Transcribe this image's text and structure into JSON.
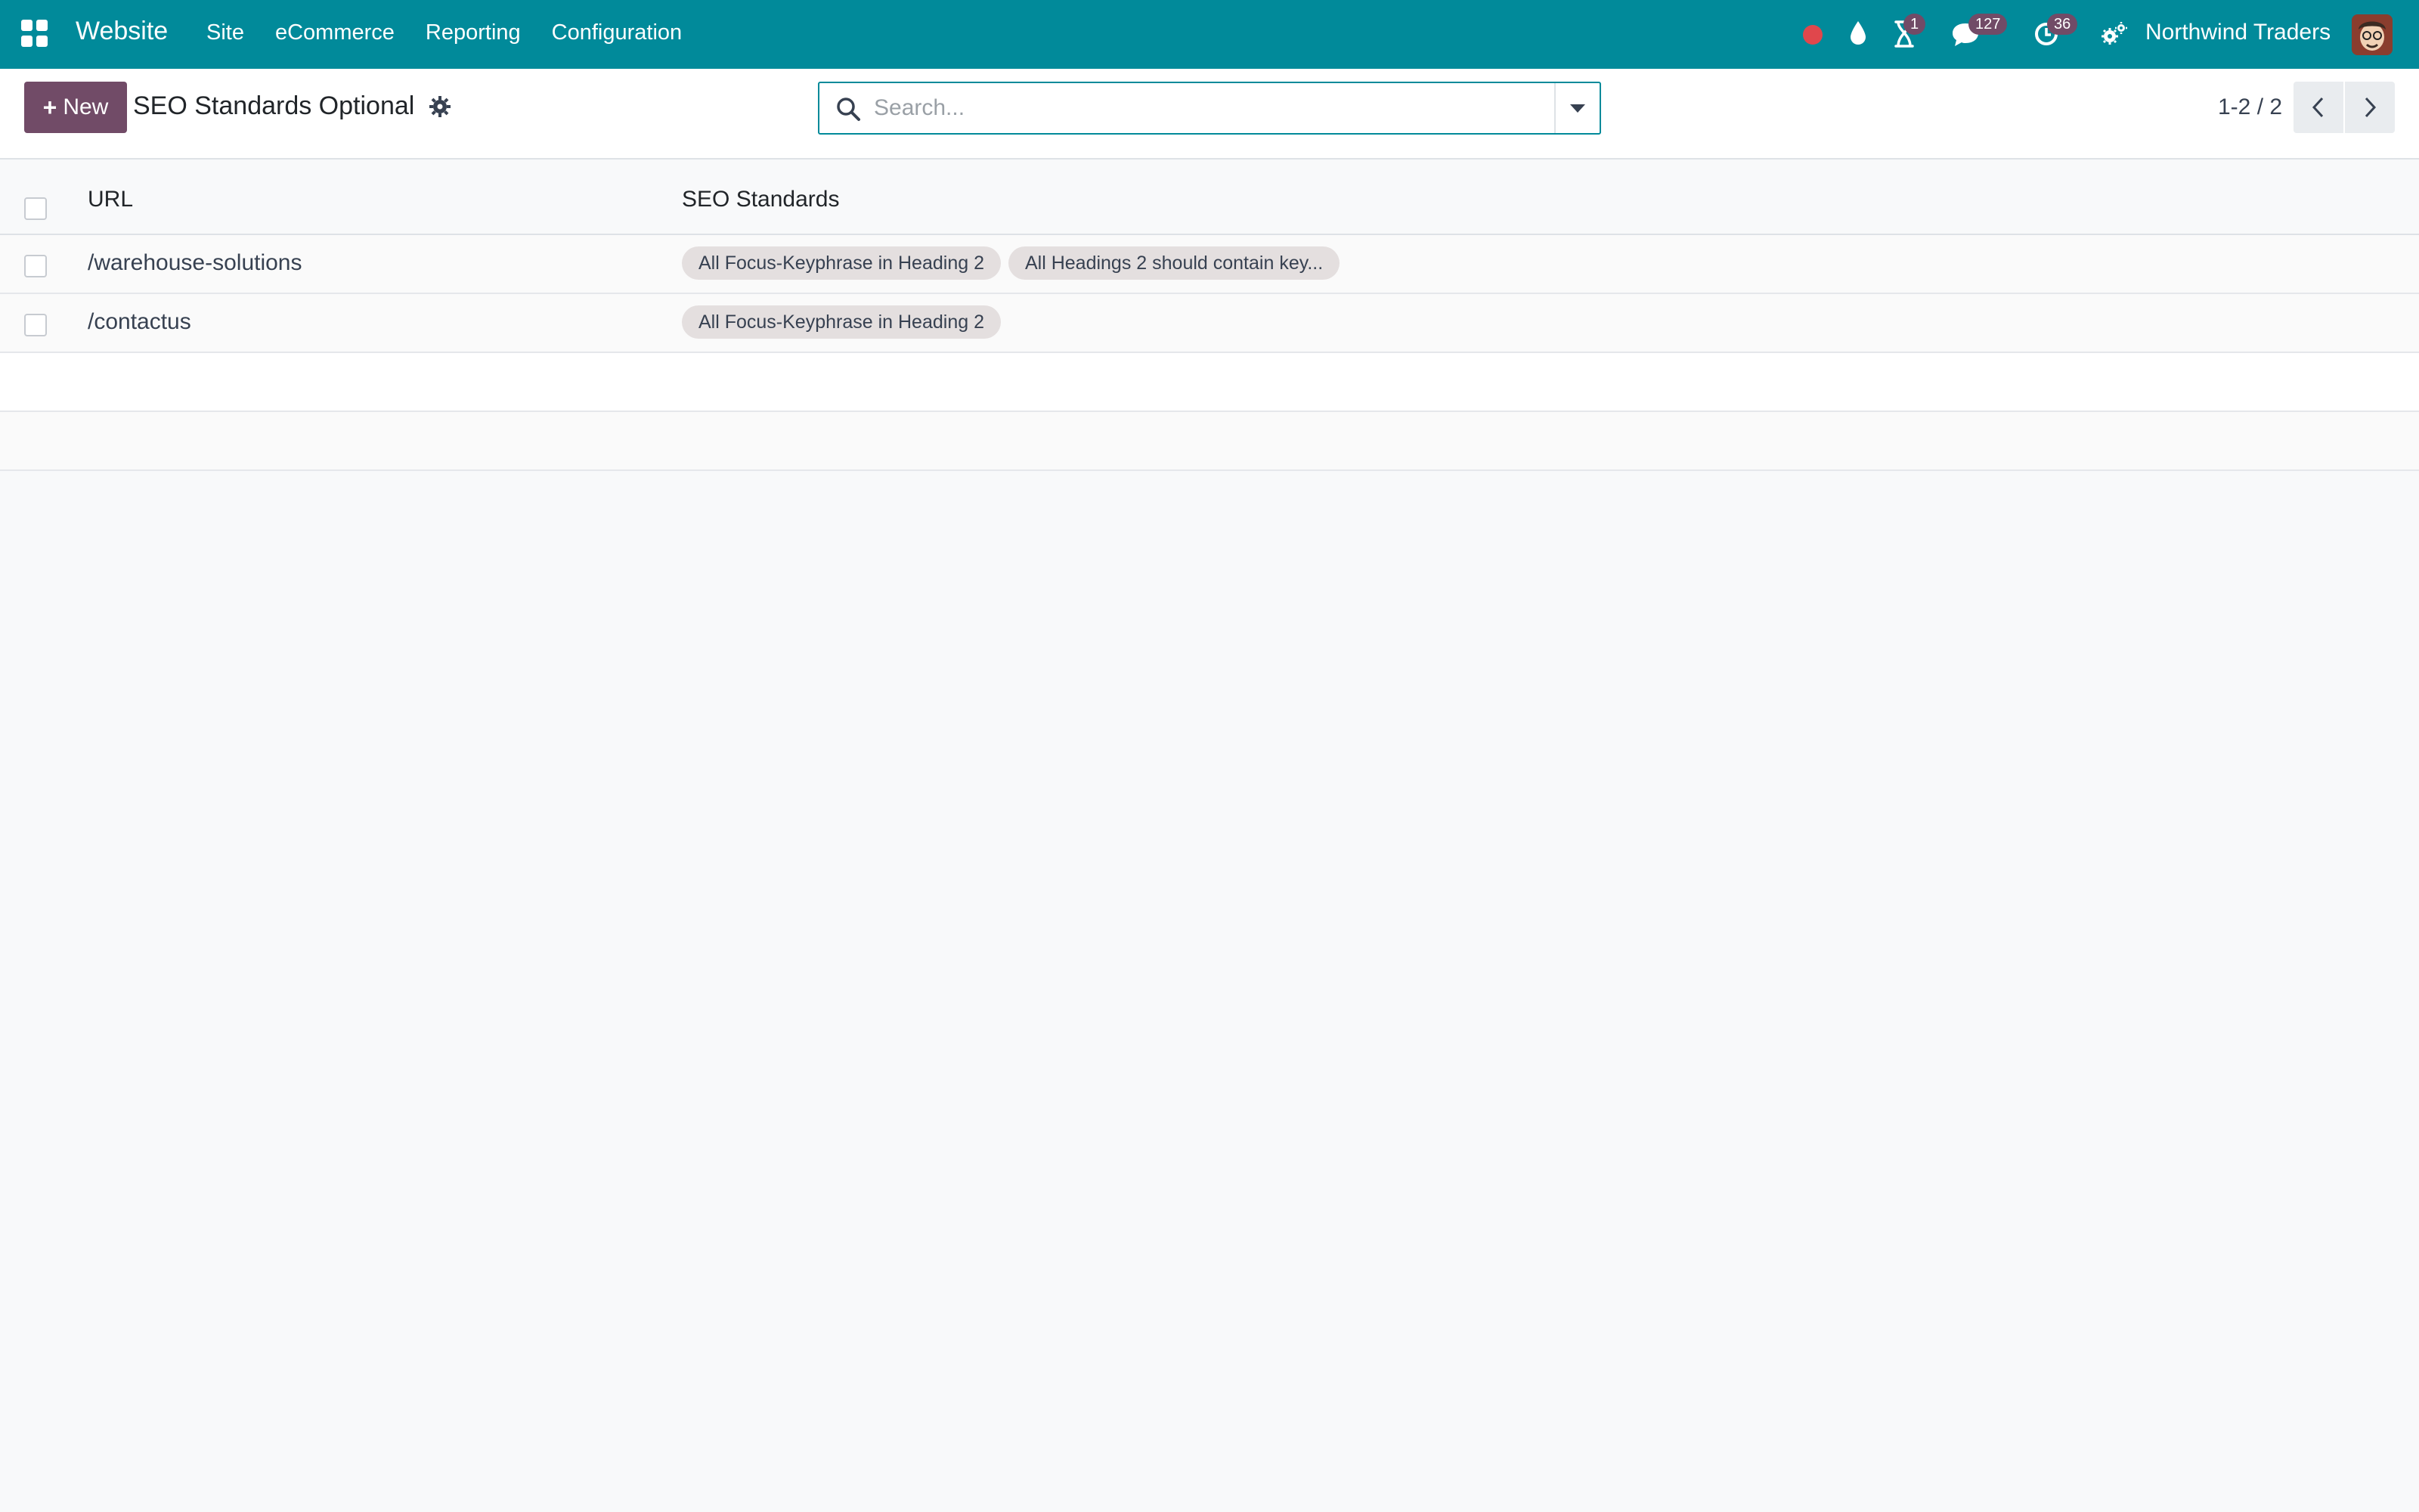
{
  "navbar": {
    "app_name": "Website",
    "menu": [
      "Site",
      "eCommerce",
      "Reporting",
      "Configuration"
    ],
    "badges": {
      "activities": "1",
      "messages": "127",
      "clock": "36"
    },
    "company": "Northwind Traders",
    "colors": {
      "bar": "#018a9a",
      "badge": "#714b67",
      "record_dot": "#e0474c"
    }
  },
  "control_panel": {
    "new_label": "New",
    "title": "SEO Standards Optional",
    "search": {
      "placeholder": "Search...",
      "value": ""
    },
    "pager": "1-2 / 2"
  },
  "list": {
    "columns": {
      "url": "URL",
      "seo": "SEO Standards"
    },
    "rows": [
      {
        "url": "/warehouse-solutions",
        "tags": [
          "All Focus-Keyphrase in Heading 2",
          "All Headings 2 should contain key..."
        ]
      },
      {
        "url": "/contactus",
        "tags": [
          "All Focus-Keyphrase in Heading 2"
        ]
      }
    ]
  }
}
